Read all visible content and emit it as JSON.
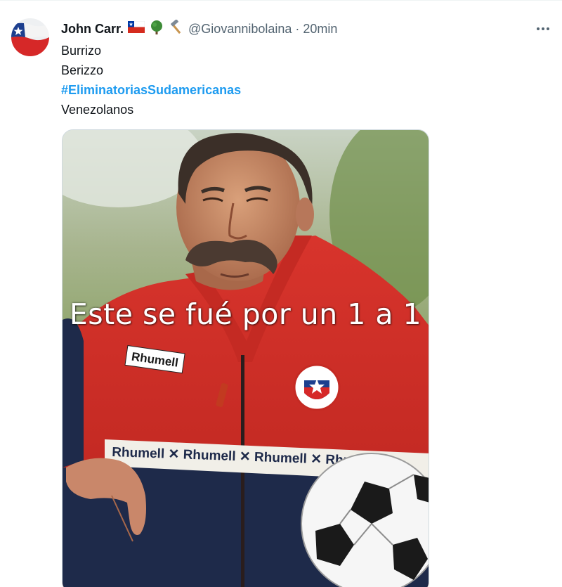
{
  "tweet": {
    "display_name": "John Carr.",
    "handle": "@Giovannibolaina",
    "separator": "·",
    "time": "20min",
    "name_emojis": [
      "chile-flag-icon",
      "tree-icon",
      "hammer-icon"
    ],
    "lines": [
      "Burrizo",
      "Berizzo"
    ],
    "hashtag": "#EliminatoriasSudamericanas",
    "last_line": "Venezolanos",
    "media": {
      "caption": "Este se fué por un 1 a 1",
      "brand_chest": "Rhumell",
      "brand_band": "Rhumell ✕ Rhumell ✕ Rhumell ✕ Rhume"
    }
  },
  "colors": {
    "link": "#1d9bf0",
    "text": "#0f1419",
    "secondary": "#536471"
  }
}
